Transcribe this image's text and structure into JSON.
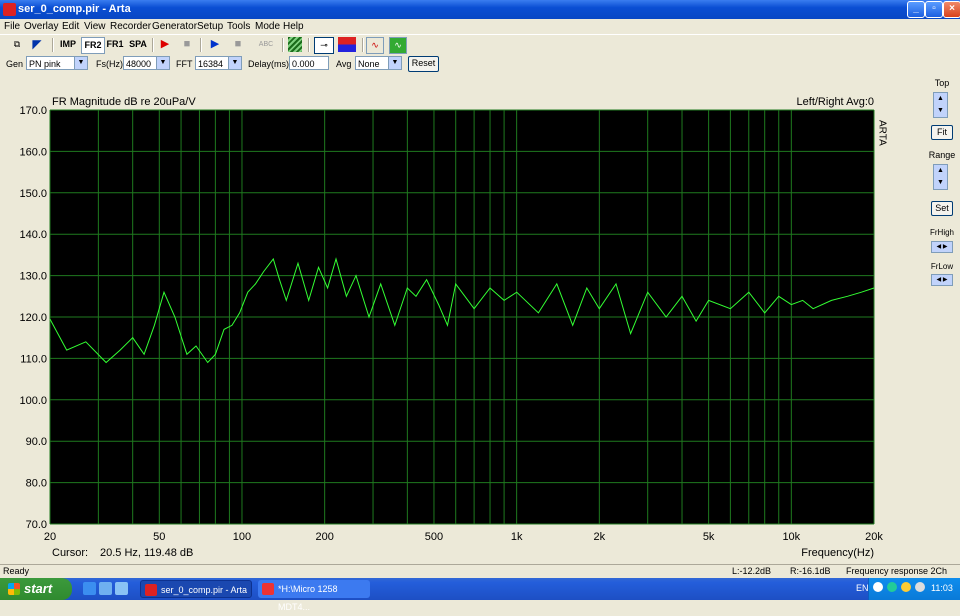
{
  "window": {
    "title": "ser_0_comp.pir - Arta",
    "min_label": "_",
    "max_label": "▫",
    "close_label": "×"
  },
  "menu": [
    "File",
    "Overlay",
    "Edit",
    "View",
    "Recorder",
    "Generator",
    "Setup",
    "Tools",
    "Mode",
    "Help"
  ],
  "toolbar": {
    "imp": "IMP",
    "fr2": "FR2",
    "fr1": "FR1",
    "spa": "SPA",
    "abc": "ABC"
  },
  "settings": {
    "gen_label": "Gen",
    "gen_value": "PN pink",
    "fs_label": "Fs(Hz)",
    "fs_value": "48000",
    "fft_label": "FFT",
    "fft_value": "16384",
    "delay_label": "Delay(ms)",
    "delay_value": "0.000",
    "avg_label": "Avg",
    "avg_value": "None",
    "reset_label": "Reset"
  },
  "right_panel": {
    "top": "Top",
    "fit": "Fit",
    "range": "Range",
    "set": "Set",
    "frhigh": "FrHigh",
    "frlow": "FrLow"
  },
  "status": {
    "ready": "Ready",
    "l": "L:-12.2dB",
    "r": "R:-16.1dB",
    "mode": "Frequency response 2Ch"
  },
  "taskbar": {
    "start": "start",
    "task1": "ser_0_comp.pir - Arta",
    "task2": "*H:\\Micro 1258 MDT4...",
    "lang": "EN",
    "clock": "11:03"
  },
  "colors": {
    "trace": "#33ff33",
    "grid": "#1f7a1f",
    "plot_bg": "#000000"
  },
  "chart_data": {
    "type": "line",
    "title": "FR Magnitude dB re 20uPa/V",
    "top_right": "Left/Right  Avg:0",
    "brand": "ARTA",
    "xlabel": "Frequency(Hz)",
    "cursor_label": "Cursor:",
    "cursor_value": "20.5 Hz, 119.48 dB",
    "x_scale": "log",
    "xlim": [
      20,
      20000
    ],
    "ylim": [
      70,
      170
    ],
    "x_tick_labels": [
      "20",
      "50",
      "100",
      "200",
      "500",
      "1k",
      "2k",
      "5k",
      "10k",
      "20k"
    ],
    "x_tick_values": [
      20,
      50,
      100,
      200,
      500,
      1000,
      2000,
      5000,
      10000,
      20000
    ],
    "y_tick_labels": [
      "170.0",
      "160.0",
      "150.0",
      "140.0",
      "130.0",
      "120.0",
      "110.0",
      "100.0",
      "90.0",
      "80.0",
      "70.0"
    ],
    "y_tick_values": [
      170,
      160,
      150,
      140,
      130,
      120,
      110,
      100,
      90,
      80,
      70
    ],
    "grid": true,
    "series": [
      {
        "x": [
          20,
          23,
          27,
          32,
          36,
          40,
          44,
          48,
          52,
          57,
          63,
          68,
          75,
          80,
          86,
          92,
          98,
          105,
          112,
          120,
          130,
          137,
          145,
          160,
          175,
          190,
          205,
          220,
          240,
          260,
          290,
          320,
          360,
          400,
          430,
          470,
          520,
          560,
          600,
          700,
          800,
          900,
          1000,
          1200,
          1400,
          1600,
          1800,
          2000,
          2300,
          2600,
          3000,
          3500,
          4000,
          4500,
          5000,
          6000,
          7000,
          8000,
          9000,
          10000,
          11000,
          12000,
          14000,
          16000,
          18000,
          20000
        ],
        "y": [
          119.5,
          112,
          114,
          109,
          112,
          115,
          111,
          118,
          126,
          120,
          111,
          113,
          109,
          111,
          117,
          118,
          121,
          126,
          128,
          131,
          134,
          129,
          124,
          133,
          124,
          132,
          127,
          134,
          125,
          130,
          120,
          128,
          118,
          127,
          125,
          129,
          123,
          118,
          128,
          122,
          127,
          124,
          126,
          121,
          128,
          118,
          127,
          122,
          128,
          116,
          126,
          120,
          125,
          119,
          124,
          122,
          126,
          121,
          125,
          123,
          124,
          122,
          124,
          125,
          126,
          127
        ]
      }
    ]
  }
}
